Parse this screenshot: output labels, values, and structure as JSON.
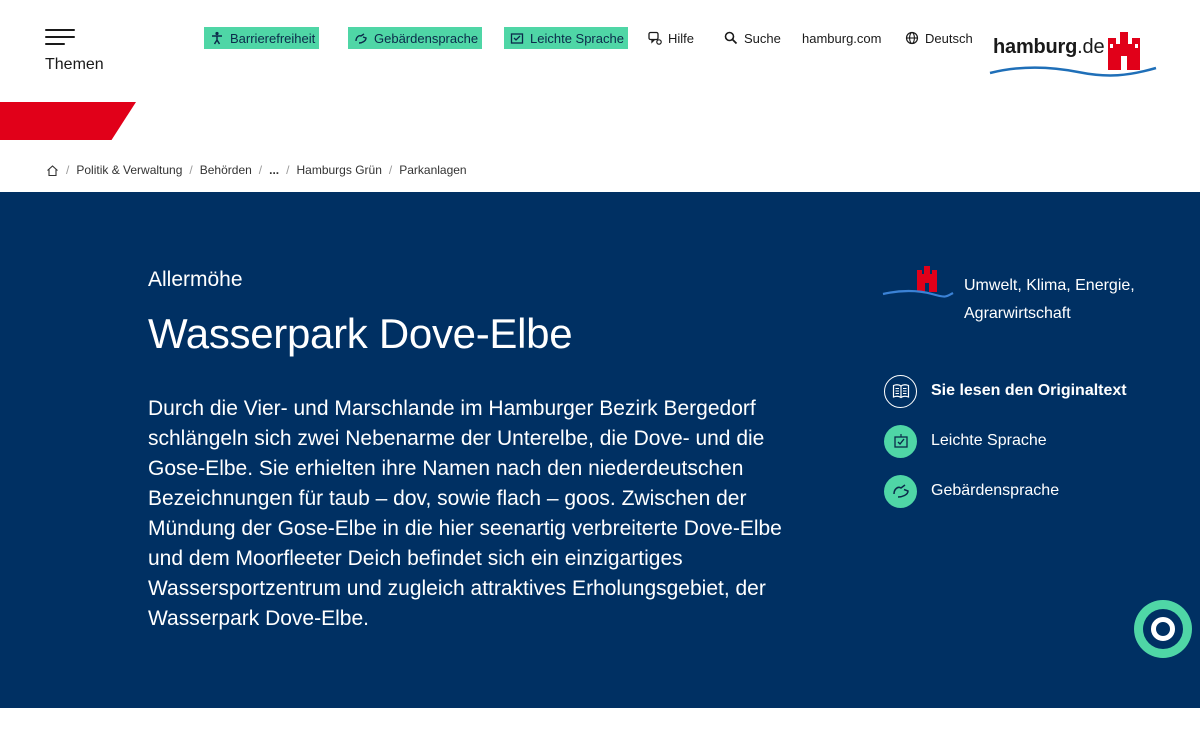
{
  "header": {
    "menu_label": "Themen",
    "nav": {
      "accessibility": "Barrierefreiheit",
      "sign_language": "Gebärdensprache",
      "easy_language": "Leichte Sprache",
      "help": "Hilfe",
      "search": "Suche",
      "portal": "hamburg.com",
      "language": "Deutsch"
    },
    "logo_main": "hamburg",
    "logo_suffix": ".de"
  },
  "breadcrumb": {
    "items": [
      "Politik & Verwaltung",
      "Behörden",
      "...",
      "Hamburgs Grün",
      "Parkanlagen"
    ],
    "separator": "/"
  },
  "hero": {
    "kicker": "Allermöhe",
    "title": "Wasserpark Dove-Elbe",
    "text": "Durch die Vier- und Marschlande im Hamburger Bezirk Bergedorf schlängeln sich zwei Nebenarme der Unterelbe, die Dove- und die Gose-Elbe. Sie erhielten ihre Namen nach den niederdeutschen Bezeichnungen für taub – dov, sowie flach – goos. Zwischen der Mündung der Gose-Elbe in die hier seenartig verbreiterte Dove-Elbe und dem Moorfleeter Deich befindet sich ein einzigartiges Wassersportzentrum und zugleich attraktives Erholungsgebiet, der Wasserpark Dove-Elbe.",
    "topic": "Umwelt, Klima, Energie, Agrarwirtschaft",
    "language_options": {
      "original": "Sie lesen den Originaltext",
      "easy": "Leichte Sprache",
      "sign": "Gebärdensprache"
    }
  },
  "colors": {
    "hero_bg": "#003063",
    "accent_green": "#4fd6a6",
    "brand_red": "#e10019",
    "wave_blue": "#1f6fb8"
  }
}
